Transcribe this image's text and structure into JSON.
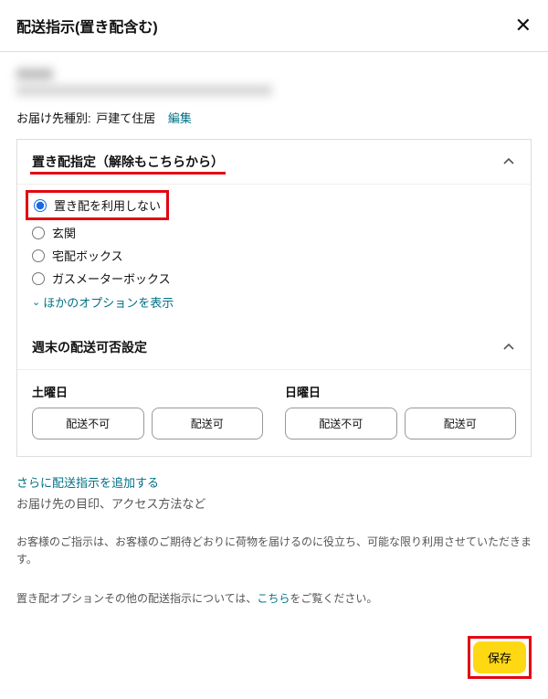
{
  "header": {
    "title": "配送指示(置き配含む)"
  },
  "address_type": {
    "label": "お届け先種別:",
    "value": "戸建て住居",
    "edit": "編集"
  },
  "sections": {
    "okihai": {
      "title": "置き配指定（解除もこちらから）",
      "options": [
        {
          "label": "置き配を利用しない",
          "selected": true,
          "highlighted": true
        },
        {
          "label": "玄関",
          "selected": false
        },
        {
          "label": "宅配ボックス",
          "selected": false
        },
        {
          "label": "ガスメーターボックス",
          "selected": false
        }
      ],
      "more": "ほかのオプションを表示"
    },
    "weekend": {
      "title": "週末の配送可否設定",
      "days": [
        {
          "label": "土曜日",
          "btn_no": "配送不可",
          "btn_yes": "配送可"
        },
        {
          "label": "日曜日",
          "btn_no": "配送不可",
          "btn_yes": "配送可"
        }
      ]
    }
  },
  "add_instruction": "さらに配送指示を追加する",
  "hint": "お届け先の目印、アクセス方法など",
  "note1": "お客様のご指示は、お客様のご期待どおりに荷物を届けるのに役立ち、可能な限り利用させていただきます。",
  "note2_pre": "置き配オプションその他の配送指示については、",
  "note2_link": "こちら",
  "note2_post": "をご覧ください。",
  "save": "保存"
}
